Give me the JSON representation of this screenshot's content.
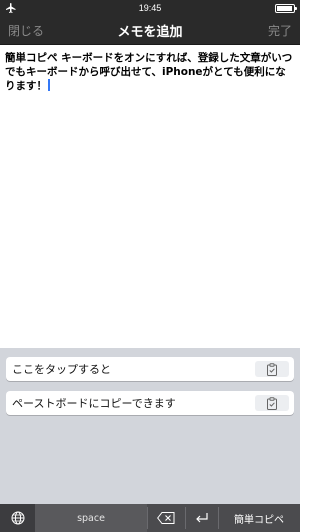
{
  "status_bar": {
    "time": "19:45",
    "airplane_icon": "airplane-icon",
    "battery_icon": "battery-icon"
  },
  "nav": {
    "close_label": "閉じる",
    "title": "メモを追加",
    "done_label": "完了"
  },
  "editor": {
    "text": "簡単コピペ キーボードをオンにすれば、登録した文章がいつでもキーボードから呼び出せて、iPhoneがとても便利になります！"
  },
  "snippets": [
    {
      "label": "ここをタップすると",
      "icon": "clipboard-icon"
    },
    {
      "label": "ペーストボードにコピーできます",
      "icon": "clipboard-icon"
    }
  ],
  "keyboard": {
    "space_label": "space",
    "keyboard_name": "簡単コピペ",
    "globe_icon": "globe-icon",
    "delete_icon": "delete-icon",
    "return_icon": "return-icon"
  },
  "colors": {
    "bar_background": "#2a2a2a",
    "keyboard_background": "#d2d5db",
    "caret": "#3478f6"
  }
}
